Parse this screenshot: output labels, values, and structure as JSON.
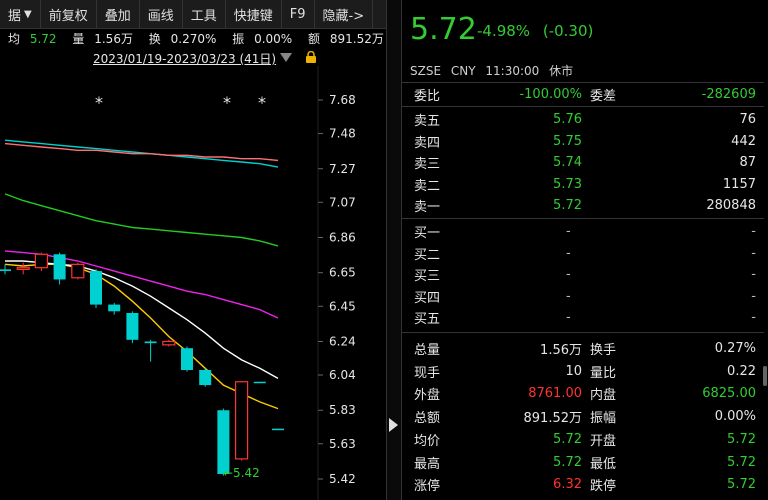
{
  "toolbar": {
    "items": [
      "据",
      "前复权",
      "叠加",
      "画线",
      "工具",
      "快捷键",
      "F9",
      "隐藏->"
    ]
  },
  "stats": {
    "avg_label": "均",
    "avg_value": "5.72",
    "vol_label": "量",
    "vol_value": "1.56万",
    "turnover_label": "换",
    "turnover_value": "0.270%",
    "amplitude_label": "振",
    "amplitude_value": "0.00%",
    "amount_label": "额",
    "amount_value": "891.52万"
  },
  "date_range": "2023/01/19-2023/03/23 (41日)",
  "chart_data": {
    "type": "candlestick",
    "y_ticks": [
      "7.68",
      "7.48",
      "7.27",
      "7.07",
      "6.86",
      "6.65",
      "6.45",
      "6.24",
      "6.04",
      "5.83",
      "5.63",
      "5.42"
    ],
    "ylim": [
      5.42,
      7.68
    ],
    "low_annotation": "5.42",
    "markers": [
      "*",
      "*",
      "*"
    ],
    "candles": [
      {
        "o": 6.67,
        "h": 6.7,
        "l": 6.64,
        "c": 6.66
      },
      {
        "o": 6.67,
        "h": 6.71,
        "l": 6.64,
        "c": 6.68
      },
      {
        "o": 6.68,
        "h": 6.77,
        "l": 6.66,
        "c": 6.76
      },
      {
        "o": 6.76,
        "h": 6.77,
        "l": 6.58,
        "c": 6.61
      },
      {
        "o": 6.62,
        "h": 6.71,
        "l": 6.61,
        "c": 6.7
      },
      {
        "o": 6.66,
        "h": 6.67,
        "l": 6.44,
        "c": 6.46
      },
      {
        "o": 6.46,
        "h": 6.47,
        "l": 6.4,
        "c": 6.42
      },
      {
        "o": 6.41,
        "h": 6.42,
        "l": 6.23,
        "c": 6.25
      },
      {
        "o": 6.24,
        "h": 6.25,
        "l": 6.12,
        "c": 6.23
      },
      {
        "o": 6.22,
        "h": 6.25,
        "l": 6.21,
        "c": 6.24
      },
      {
        "o": 6.2,
        "h": 6.21,
        "l": 6.06,
        "c": 6.07
      },
      {
        "o": 6.07,
        "h": 6.08,
        "l": 5.97,
        "c": 5.98
      },
      {
        "o": 5.83,
        "h": 5.84,
        "l": 5.44,
        "c": 5.45
      },
      {
        "o": 5.54,
        "h": 6.0,
        "l": 5.53,
        "c": 6.0
      },
      {
        "o": 6.0,
        "h": 6.0,
        "l": 6.0,
        "c": 6.0
      },
      {
        "o": 5.72,
        "h": 5.72,
        "l": 5.72,
        "c": 5.72
      }
    ],
    "series": [
      {
        "color": "#00d0d0",
        "values": [
          7.44,
          7.43,
          7.42,
          7.41,
          7.4,
          7.39,
          7.38,
          7.37,
          7.36,
          7.35,
          7.34,
          7.33,
          7.32,
          7.31,
          7.3,
          7.28
        ]
      },
      {
        "color": "#ff7070",
        "values": [
          7.42,
          7.41,
          7.4,
          7.39,
          7.38,
          7.38,
          7.37,
          7.36,
          7.36,
          7.35,
          7.35,
          7.34,
          7.34,
          7.33,
          7.33,
          7.32
        ]
      },
      {
        "color": "#22cc22",
        "values": [
          7.12,
          7.08,
          7.05,
          7.02,
          6.99,
          6.96,
          6.94,
          6.92,
          6.91,
          6.9,
          6.89,
          6.88,
          6.87,
          6.86,
          6.84,
          6.81
        ]
      },
      {
        "color": "#ee22ee",
        "values": [
          6.78,
          6.77,
          6.76,
          6.74,
          6.72,
          6.69,
          6.66,
          6.63,
          6.6,
          6.57,
          6.54,
          6.52,
          6.49,
          6.46,
          6.43,
          6.38
        ]
      },
      {
        "color": "#ffcc00",
        "values": [
          6.7,
          6.69,
          6.7,
          6.7,
          6.68,
          6.64,
          6.57,
          6.48,
          6.38,
          6.27,
          6.18,
          6.08,
          5.98,
          5.93,
          5.88,
          5.84
        ]
      },
      {
        "color": "#ffffff",
        "values": [
          6.72,
          6.72,
          6.71,
          6.7,
          6.69,
          6.66,
          6.62,
          6.57,
          6.51,
          6.44,
          6.37,
          6.29,
          6.2,
          6.13,
          6.08,
          6.02
        ]
      }
    ]
  },
  "quote": {
    "price": "5.72",
    "change_pct": "-4.98%",
    "change": "(-0.30)",
    "exchange": "SZSE",
    "currency": "CNY",
    "time": "11:30:00",
    "status": "休市"
  },
  "order_ratio": {
    "label": "委比",
    "value": "-100.00%",
    "diff_label": "委差",
    "diff_value": "-282609"
  },
  "asks": [
    {
      "label": "卖五",
      "price": "5.76",
      "vol": "76"
    },
    {
      "label": "卖四",
      "price": "5.75",
      "vol": "442"
    },
    {
      "label": "卖三",
      "price": "5.74",
      "vol": "87"
    },
    {
      "label": "卖二",
      "price": "5.73",
      "vol": "1157"
    },
    {
      "label": "卖一",
      "price": "5.72",
      "vol": "280848"
    }
  ],
  "bids": [
    {
      "label": "买一",
      "price": "-",
      "vol": "-"
    },
    {
      "label": "买二",
      "price": "-",
      "vol": "-"
    },
    {
      "label": "买三",
      "price": "-",
      "vol": "-"
    },
    {
      "label": "买四",
      "price": "-",
      "vol": "-"
    },
    {
      "label": "买五",
      "price": "-",
      "vol": "-"
    }
  ],
  "details": [
    {
      "l1": "总量",
      "v1": "1.56万",
      "c1": "white",
      "l2": "换手",
      "v2": "0.27%",
      "c2": "white"
    },
    {
      "l1": "现手",
      "v1": "10",
      "c1": "white",
      "l2": "量比",
      "v2": "0.22",
      "c2": "white"
    },
    {
      "l1": "外盘",
      "v1": "8761.00",
      "c1": "red",
      "l2": "内盘",
      "v2": "6825.00",
      "c2": "green"
    },
    {
      "l1": "总额",
      "v1": "891.52万",
      "c1": "white",
      "l2": "振幅",
      "v2": "0.00%",
      "c2": "white"
    },
    {
      "l1": "均价",
      "v1": "5.72",
      "c1": "green",
      "l2": "开盘",
      "v2": "5.72",
      "c2": "green"
    },
    {
      "l1": "最高",
      "v1": "5.72",
      "c1": "green",
      "l2": "最低",
      "v2": "5.72",
      "c2": "green"
    },
    {
      "l1": "涨停",
      "v1": "6.32",
      "c1": "red",
      "l2": "跌停",
      "v2": "5.72",
      "c2": "green"
    }
  ]
}
